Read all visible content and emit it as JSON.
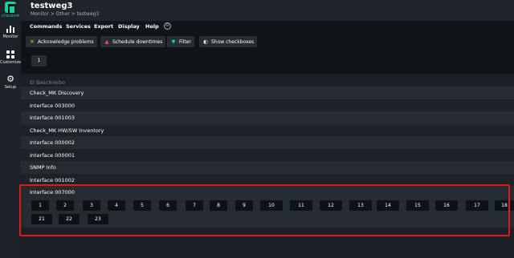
{
  "app": {
    "brand": "checkmk",
    "title": "testweg3",
    "breadcrumb": "Monitor > Other > testweg3"
  },
  "sidebar": {
    "items": [
      {
        "label": "Monitor",
        "icon": "monitor-bars-icon"
      },
      {
        "label": "Customize",
        "icon": "customize-grid-icon"
      },
      {
        "label": "Setup",
        "icon": "setup-gear-icon"
      }
    ]
  },
  "menubar": {
    "items": [
      "Commands",
      "Services",
      "Export",
      "Display",
      "Help"
    ],
    "more_icon": "⊖"
  },
  "toolbar": {
    "acknowledge": "Acknowledge problems",
    "schedule": "Schedule downtimes",
    "filter": "Filter",
    "checkboxes": "Show checkboxes"
  },
  "pagination_top": "1",
  "table": {
    "header": "El Beschreibo",
    "rows": [
      "Check_MK Discovery",
      "Interface 003000",
      "Interface 001003",
      "Check_MK HW/SW Inventory",
      "Interface 000002",
      "Interface 000001",
      "SNMP Info",
      "Interface 001002",
      "Interface 007000"
    ],
    "number_buttons": [
      "1",
      "2",
      "3",
      "4",
      "5",
      "6",
      "7",
      "8",
      "9",
      "10",
      "11",
      "12",
      "13",
      "14",
      "15",
      "16",
      "17",
      "18",
      "21",
      "22",
      "23"
    ]
  },
  "colors": {
    "accent": "#15d1a0",
    "highlight_border": "#e0191a",
    "background": "#0f1418"
  }
}
